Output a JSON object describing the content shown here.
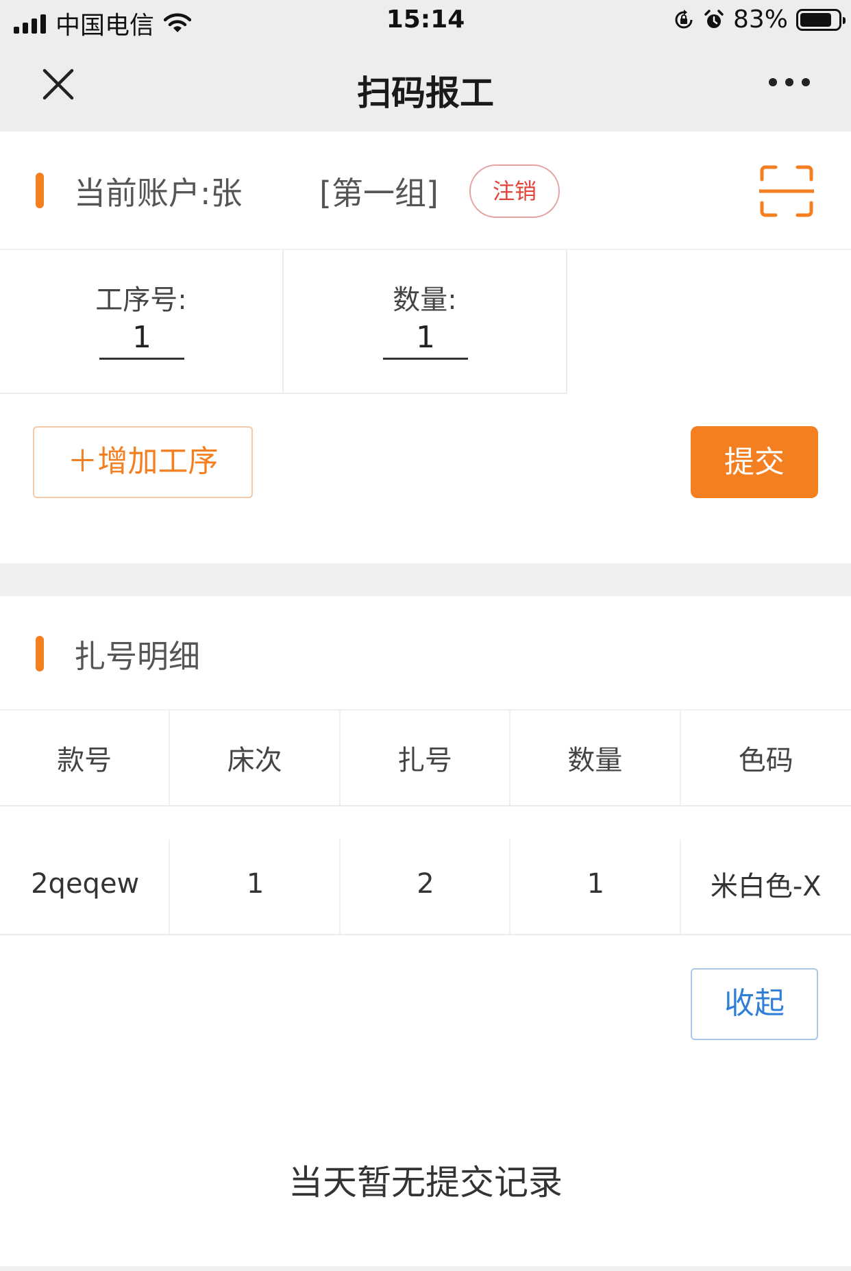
{
  "status_bar": {
    "carrier": "中国电信",
    "time": "15:14",
    "battery": "83%",
    "battery_level": 0.83
  },
  "nav": {
    "title": "扫码报工",
    "close_icon": "close-icon",
    "more_icon": "more-icon"
  },
  "account": {
    "label": "当前账户:张",
    "group": "[第一组]",
    "logout_label": "注销",
    "scan_icon": "scan-icon"
  },
  "inputs": {
    "process_label": "工序号:",
    "process_value": "1",
    "quantity_label": "数量:",
    "quantity_value": "1"
  },
  "actions": {
    "add_process_label": "＋增加工序",
    "submit_label": "提交"
  },
  "detail": {
    "title": "扎号明细",
    "columns": [
      "款号",
      "床次",
      "扎号",
      "数量",
      "色码"
    ],
    "rows": [
      [
        "2qeqew",
        "1",
        "2",
        "1",
        "米白色-X"
      ]
    ],
    "collapse_label": "收起"
  },
  "empty_message": "当天暂无提交记录",
  "colors": {
    "accent": "#f47f20",
    "logout": "#e0443a",
    "link_blue": "#2f7ed8"
  }
}
